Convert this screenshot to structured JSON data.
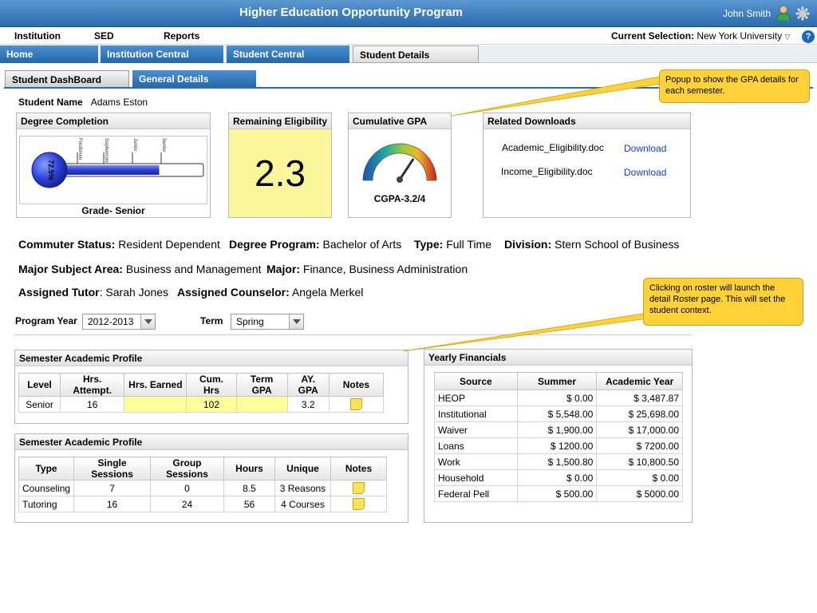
{
  "header": {
    "title": "Higher Education Opportunity Program",
    "user_name": "John  Smith",
    "user_icon": "user-icon",
    "settings_icon": "gear-icon"
  },
  "menu": {
    "items": [
      "Institution",
      "SED",
      "Reports"
    ],
    "current_selection_label": "Current Selection:",
    "current_selection_value": "New York University",
    "help_label": "?"
  },
  "nav_tabs": [
    "Home",
    "Institution Central",
    "Student Central",
    "Student Details"
  ],
  "sub_tabs": [
    "Student DashBoard",
    "General Details"
  ],
  "student": {
    "name_label": "Student Name",
    "name": "Adams Eston"
  },
  "degree_completion": {
    "title": "Degree Completion",
    "percent_label": "72.5%",
    "progress_fraction": 0.725,
    "levels": [
      "Freshmen",
      "Sophomore",
      "Junior",
      "Senior"
    ],
    "grade": "Grade- Senior"
  },
  "remaining_eligibility": {
    "title": "Remaining Eligibility",
    "value": "2.3"
  },
  "cumulative_gpa": {
    "title": "Cumulative GPA",
    "label": "CGPA-3.2/4",
    "value": 3.2,
    "max": 4
  },
  "downloads": {
    "title": "Related Downloads",
    "items": [
      {
        "file": "Academic_Eligibility.doc",
        "link": "Download"
      },
      {
        "file": "Income_Eligibility.doc",
        "link": "Download"
      }
    ]
  },
  "info": {
    "commuter_label": "Commuter Status:",
    "commuter": "Resident Dependent",
    "degree_label": "Degree Program:",
    "degree": "Bachelor of Arts",
    "type_label": "Type:",
    "type": "Full Time",
    "division_label": "Division:",
    "division": "Stern School of Business",
    "major_area_label": "Major Subject Area:",
    "major_area": "Business and Management",
    "major_label": "Major:",
    "major": "Finance, Business Administration",
    "tutor_label": "Assigned Tutor",
    "tutor": "Sarah Jones",
    "counselor_label": "Assigned Counselor:",
    "counselor": "Angela Merkel"
  },
  "filters": {
    "program_year_label": "Program Year",
    "program_year": "2012-2013",
    "term_label": "Term",
    "term": "Spring"
  },
  "semester_profile": {
    "title": "Semester Academic Profile",
    "headers": [
      "Level",
      "Hrs. Attempt.",
      "Hrs. Earned",
      "Cum. Hrs",
      "Term GPA",
      "AY. GPA",
      "Notes"
    ],
    "row": [
      "Senior",
      "16",
      "",
      "102",
      "",
      "3.2"
    ]
  },
  "sessions_profile": {
    "title": "Semester Academic Profile",
    "headers": [
      "Type",
      "Single Sessions",
      "Group Sessions",
      "Hours",
      "Unique",
      "Notes"
    ],
    "rows": [
      [
        "Counseling",
        "7",
        "0",
        "8.5",
        "3 Reasons"
      ],
      [
        "Tutoring",
        "16",
        "24",
        "56",
        "4 Courses"
      ]
    ]
  },
  "financials": {
    "title": "Yearly Financials",
    "headers": [
      "Source",
      "Summer",
      "Academic Year"
    ],
    "rows": [
      [
        "HEOP",
        "$ 0.00",
        "$ 3,487.87"
      ],
      [
        "Institutional",
        "$ 5,548.00",
        "$ 25,698.00"
      ],
      [
        "Waiver",
        "$ 1,900.00",
        "$ 17,000.00"
      ],
      [
        "Loans",
        "$ 1200.00",
        "$ 7200.00"
      ],
      [
        "Work",
        "$ 1,500.80",
        "$ 10,800.50"
      ],
      [
        "Household",
        "$ 0.00",
        "$ 0.00"
      ],
      [
        "Federal Pell",
        "$ 500.00",
        "$ 5000.00"
      ]
    ]
  },
  "callouts": {
    "gpa": "Popup to show the GPA details for each semester.",
    "roster": "Clicking on roster will launch the detail Roster page. This will set the student context."
  },
  "colors": {
    "header_blue": "#2b6cad",
    "highlight_yellow": "#ffff99",
    "callout": "#ffd23a",
    "link": "#1a3fc2"
  }
}
